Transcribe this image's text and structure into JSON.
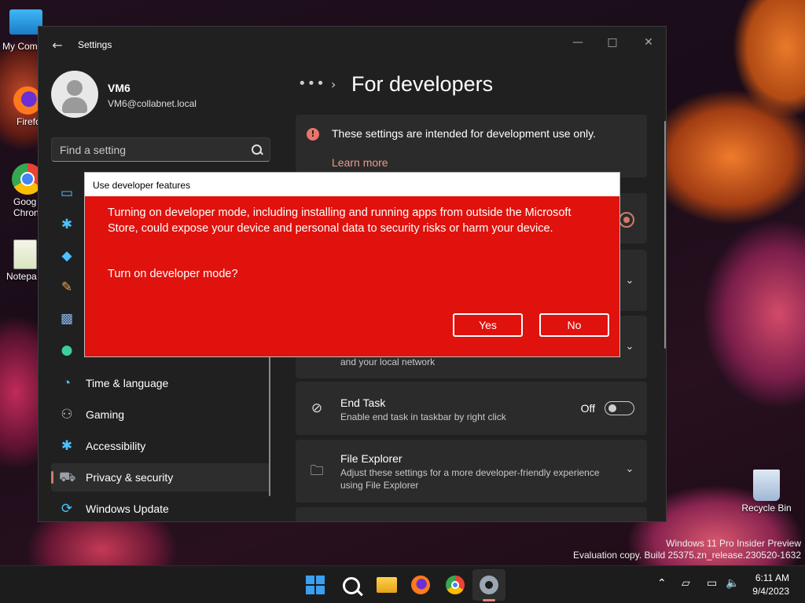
{
  "desktop": {
    "icons": [
      {
        "label": "My Com"
      },
      {
        "label": "Firefo"
      },
      {
        "label": "Goog Chron"
      },
      {
        "label": "Notepa"
      },
      {
        "label": "Recycle Bin"
      }
    ],
    "watermark": {
      "line1": "Windows 11 Pro Insider Preview",
      "line2": "Evaluation copy. Build 25375.zn_release.230520-1632"
    }
  },
  "window": {
    "title": "Settings",
    "user": {
      "name": "VM6",
      "email": "VM6@collabnet.local"
    },
    "search": {
      "placeholder": "Find a setting"
    },
    "nav": [
      {
        "label": "Time & language",
        "icon": "globe-clock-icon"
      },
      {
        "label": "Gaming",
        "icon": "gamepad-icon"
      },
      {
        "label": "Accessibility",
        "icon": "accessibility-icon"
      },
      {
        "label": "Privacy & security",
        "icon": "shield-icon",
        "active": true
      },
      {
        "label": "Windows Update",
        "icon": "update-icon"
      }
    ],
    "page_title": "For developers",
    "info_card": {
      "text": "These settings are intended for development use only.",
      "link": "Learn more"
    },
    "rows": {
      "network_desc_partial": "and your local network",
      "end_task": {
        "title": "End Task",
        "desc": "Enable end task in taskbar by right click",
        "state": "Off"
      },
      "file_explorer": {
        "title": "File Explorer",
        "desc": "Adjust these settings for a more developer-friendly experience using File Explorer"
      }
    }
  },
  "dialog": {
    "title": "Use developer features",
    "message": "Turning on developer mode, including installing and running apps from outside the Microsoft Store, could expose your device and personal data to security risks or harm your device.",
    "question": "Turn on developer mode?",
    "yes": "Yes",
    "no": "No",
    "background": "#e0120d"
  },
  "taskbar": {
    "time": "6:11 AM",
    "date": "9/4/2023"
  },
  "colors": {
    "accent": "#d07a6a",
    "window_bg": "#202020",
    "card_bg": "#2b2b2b"
  }
}
